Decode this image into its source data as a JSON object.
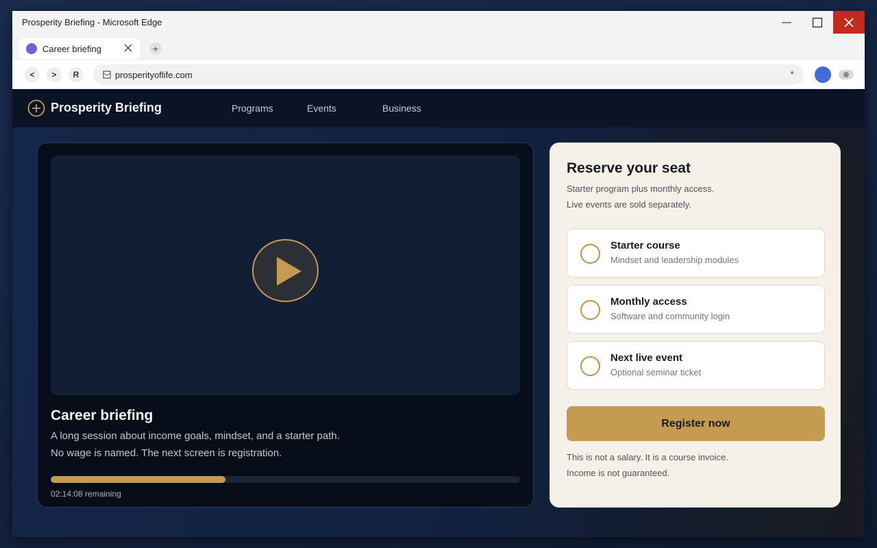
{
  "window": {
    "title": "Prosperity Briefing - Microsoft Edge",
    "tab_label": "Career briefing",
    "new_tab_label": "+",
    "nav": {
      "back": "<",
      "forward": ">",
      "reload": "R"
    },
    "url": "prosperityoflife.com",
    "favorite_icon": "*"
  },
  "site": {
    "brand": "Prosperity Briefing",
    "nav": [
      "Programs",
      "Events",
      "Business"
    ]
  },
  "video": {
    "title": "Career briefing",
    "description": [
      "A long session about income goals, mindset, and a starter path.",
      "No wage is named. The next screen is registration."
    ],
    "progress_fraction": 0.372,
    "time_remaining": "02:14:08  remaining"
  },
  "reserve": {
    "title": "Reserve your seat",
    "subtitle": [
      "Starter program plus monthly access.",
      "Live events are sold separately."
    ],
    "options": [
      {
        "title": "Starter course",
        "desc": "Mindset and leadership modules"
      },
      {
        "title": "Monthly access",
        "desc": "Software and community login"
      },
      {
        "title": "Next live event",
        "desc": "Optional seminar ticket"
      }
    ],
    "register_label": "Register now",
    "disclaimer": [
      "This is not a salary. It is a course invoice.",
      "Income is not guaranteed."
    ]
  },
  "colors": {
    "accent": "#c59b51",
    "header_bg": "#0a1425",
    "card_bg": "#f6f1e8",
    "close_red": "#c42b1c"
  }
}
